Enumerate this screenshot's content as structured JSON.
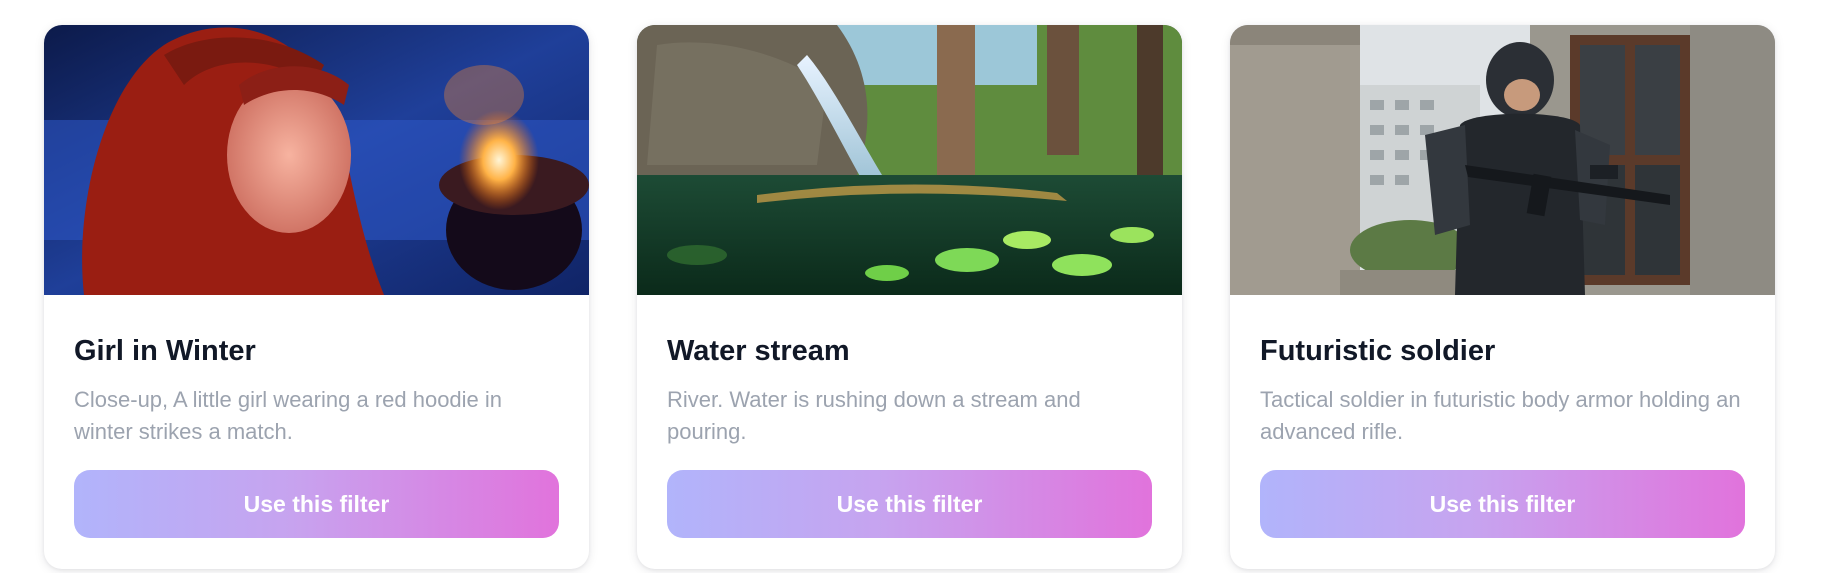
{
  "cards": [
    {
      "title": "Girl in Winter",
      "description": "Close-up, A little girl wearing a red hoodie in winter strikes a match.",
      "button_label": "Use this filter",
      "image": "girl-in-winter-photo"
    },
    {
      "title": "Water stream",
      "description": "River. Water is rushing down a stream and pouring.",
      "button_label": "Use this filter",
      "image": "water-stream-photo"
    },
    {
      "title": "Futuristic soldier",
      "description": "Tactical soldier in futuristic body armor holding an advanced rifle.",
      "button_label": "Use this filter",
      "image": "futuristic-soldier-photo"
    }
  ],
  "colors": {
    "title": "#111827",
    "description": "#9ca3af",
    "button_gradient_start": "#b1b4fb",
    "button_gradient_end": "#e173dc"
  }
}
